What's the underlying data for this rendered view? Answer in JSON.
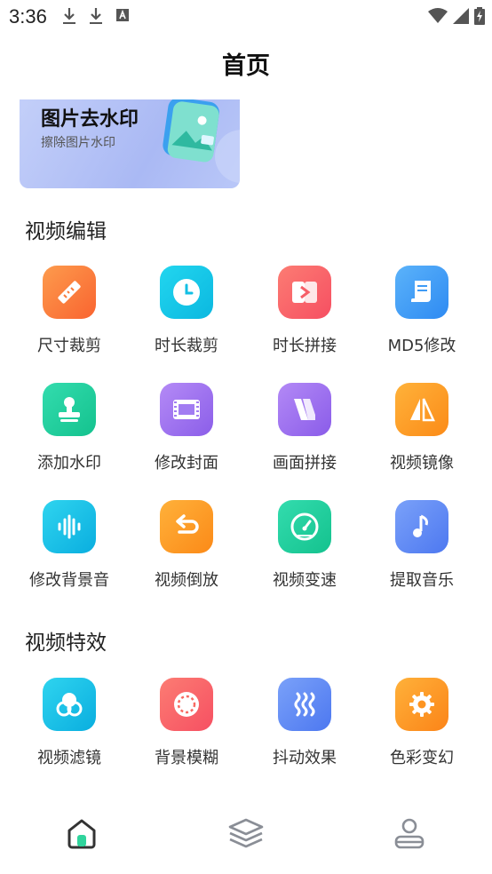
{
  "status_bar": {
    "time": "3:36"
  },
  "header": {
    "title": "首页"
  },
  "banner": {
    "title": "图片去水印",
    "subtitle": "擦除图片水印"
  },
  "sections": [
    {
      "title": "视频编辑",
      "items": [
        {
          "label": "尺寸裁剪",
          "icon": "ruler-icon",
          "color": "#fb7a3f"
        },
        {
          "label": "时长裁剪",
          "icon": "clock-icon",
          "color": "#15c9e8"
        },
        {
          "label": "时长拼接",
          "icon": "splice-icon",
          "color": "#f9646a"
        },
        {
          "label": "MD5修改",
          "icon": "document-icon",
          "color": "#3f9bf5"
        },
        {
          "label": "添加水印",
          "icon": "stamp-icon",
          "color": "#1fcf9c"
        },
        {
          "label": "修改封面",
          "icon": "film-icon",
          "color": "#9f72f0"
        },
        {
          "label": "画面拼接",
          "icon": "panels-icon",
          "color": "#9f6ff0"
        },
        {
          "label": "视频镜像",
          "icon": "mirror-icon",
          "color": "#fd9d22"
        },
        {
          "label": "修改背景音",
          "icon": "waveform-icon",
          "color": "#16bfe6"
        },
        {
          "label": "视频倒放",
          "icon": "reverse-icon",
          "color": "#fd9b22"
        },
        {
          "label": "视频变速",
          "icon": "speedometer-icon",
          "color": "#1fcda0"
        },
        {
          "label": "提取音乐",
          "icon": "music-note-icon",
          "color": "#5f88f6"
        }
      ]
    },
    {
      "title": "视频特效",
      "items": [
        {
          "label": "视频滤镜",
          "icon": "filter-icon",
          "color": "#16c2e6"
        },
        {
          "label": "背景模糊",
          "icon": "blur-icon",
          "color": "#f96a62"
        },
        {
          "label": "抖动效果",
          "icon": "shake-icon",
          "color": "#5e8cf6"
        },
        {
          "label": "色彩变幻",
          "icon": "gear-color-icon",
          "color": "#fd9420"
        }
      ]
    }
  ],
  "bottom_nav": [
    {
      "name": "home",
      "icon": "home-icon"
    },
    {
      "name": "layers",
      "icon": "layers-icon"
    },
    {
      "name": "profile",
      "icon": "user-icon"
    }
  ]
}
